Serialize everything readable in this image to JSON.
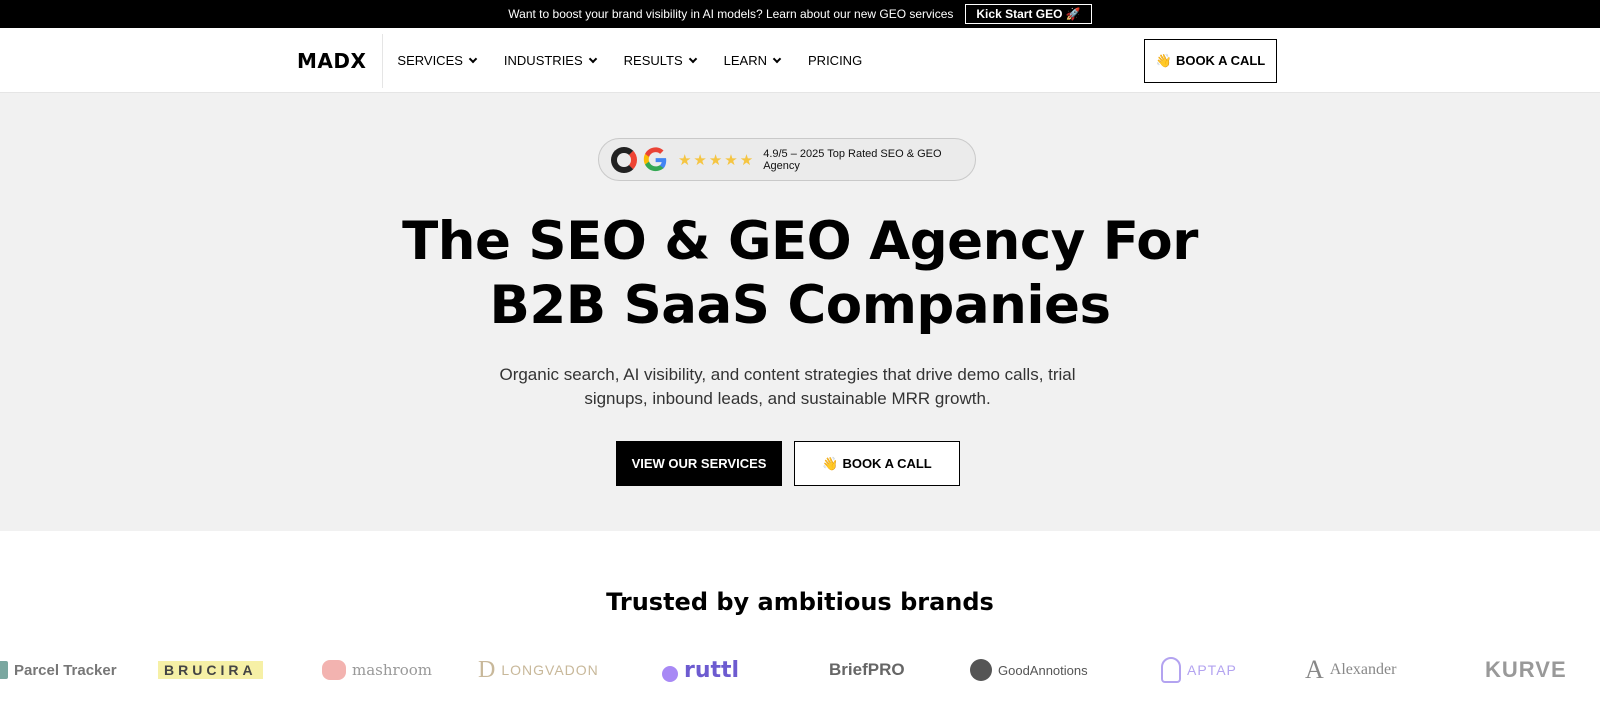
{
  "announcement": {
    "text": "Want to boost your brand visibility in AI models? Learn about our new GEO services",
    "button_label": "Kick Start GEO 🚀"
  },
  "header": {
    "logo": "MADX",
    "nav": [
      {
        "label": "SERVICES",
        "dropdown": true
      },
      {
        "label": "INDUSTRIES",
        "dropdown": true
      },
      {
        "label": "RESULTS",
        "dropdown": true
      },
      {
        "label": "LEARN",
        "dropdown": true
      },
      {
        "label": "PRICING",
        "dropdown": false
      }
    ],
    "cta_emoji": "👋",
    "cta_label": "BOOK A CALL"
  },
  "hero": {
    "rating_text": "4.9/5 – 2025 Top Rated SEO & GEO Agency",
    "stars": 5,
    "title_line1": "The SEO & GEO Agency For",
    "title_line2": "B2B SaaS Companies",
    "subtitle": "Organic search, AI visibility, and content strategies that drive demo calls, trial signups, inbound leads, and sustainable MRR growth.",
    "primary_cta": "VIEW OUR SERVICES",
    "secondary_cta_emoji": "👋",
    "secondary_cta": "BOOK A CALL"
  },
  "trusted": {
    "title": "Trusted by ambitious brands",
    "brands": [
      "Parcel Tracker",
      "BRUCIRA",
      "mashroom",
      "LONGVADON",
      "ruttl",
      "BriefPRO",
      "GoodAnnotions",
      "APTAP",
      "Alexander",
      "KURVE"
    ]
  },
  "colors": {
    "announcement_bg": "#000000",
    "hero_bg": "#f1f1f1",
    "star": "#f5c542",
    "primary_button": "#000000"
  }
}
